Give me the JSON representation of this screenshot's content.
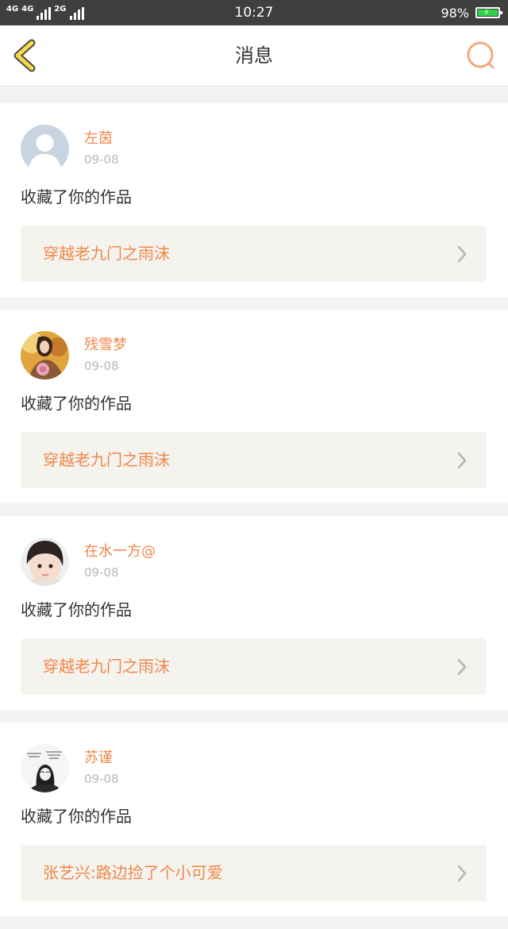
{
  "status_bar": {
    "network_1": "4G",
    "network_2": "4G",
    "network_3": "2G",
    "time": "10:27",
    "battery": "98%",
    "battery_level": 0.98,
    "battery_color": "#2fd34a"
  },
  "header": {
    "title": "消息",
    "back_icon": "chevron-left-icon",
    "search_icon": "search-icon",
    "accent": "#f0874a"
  },
  "messages": [
    {
      "user": "左茵",
      "date": "09-08",
      "action": "收藏了你的作品",
      "work": "穿越老九门之雨沫",
      "avatar": "default-avatar-icon"
    },
    {
      "user": "残雪梦",
      "date": "09-08",
      "action": "收藏了你的作品",
      "work": "穿越老九门之雨沫",
      "avatar": "photo-avatar"
    },
    {
      "user": "在水一方@",
      "date": "09-08",
      "action": "收藏了你的作品",
      "work": "穿越老九门之雨沫",
      "avatar": "photo-avatar"
    },
    {
      "user": "苏谨",
      "date": "09-08",
      "action": "收藏了你的作品",
      "work": "张艺兴:路边捡了个小可爱",
      "avatar": "photo-avatar"
    }
  ]
}
